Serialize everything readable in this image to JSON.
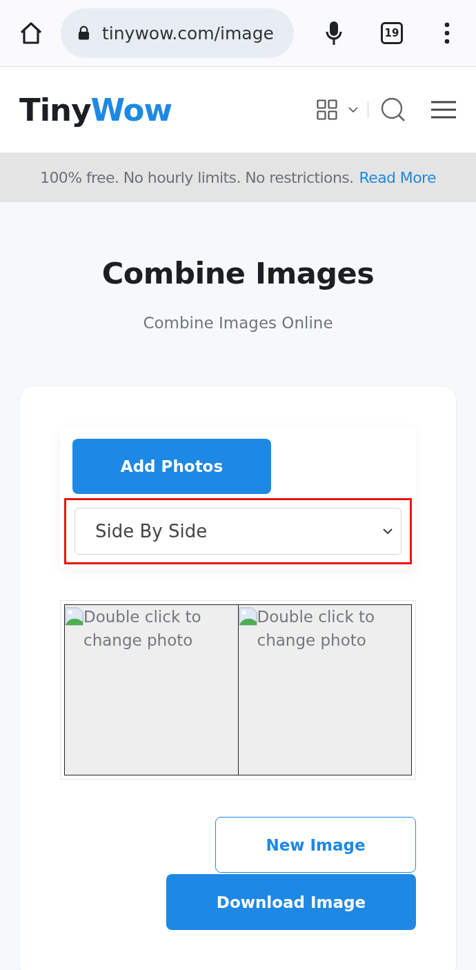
{
  "browser": {
    "url": "tinywow.com/image",
    "tab_count": "19"
  },
  "logo": {
    "parts": [
      {
        "text": "Tiny",
        "color": "#1b1f24"
      },
      {
        "text": "Wow",
        "color": "#1e88e5"
      }
    ]
  },
  "banner": {
    "text": "100% free. No hourly limits. No restrictions.",
    "link": "Read More"
  },
  "title": "Combine Images",
  "subtitle": "Combine Images Online",
  "add_button": "Add Photos",
  "layout_select": {
    "value": "Side By Side",
    "highlighted": true
  },
  "photos": [
    {
      "alt": "Double click to change photo"
    },
    {
      "alt": "Double click to change photo"
    }
  ],
  "buttons": [
    {
      "label": "New Image",
      "kind": "outline"
    },
    {
      "label": "Download Image",
      "kind": "filled"
    }
  ]
}
